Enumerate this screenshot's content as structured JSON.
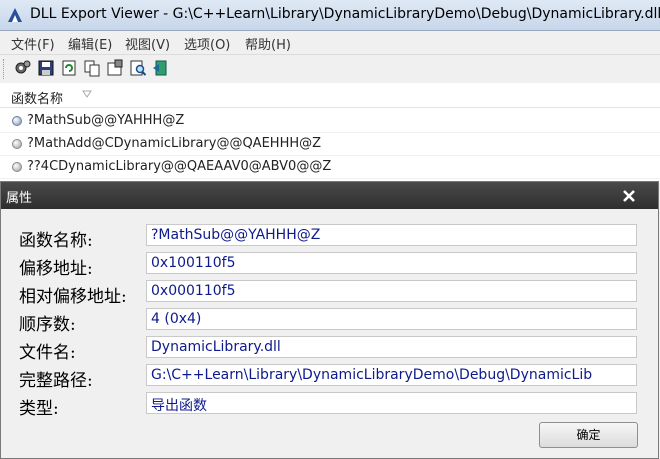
{
  "window": {
    "title": "DLL Export Viewer   -   G:\\C++Learn\\Library\\DynamicLibraryDemo\\Debug\\DynamicLibrary.dll"
  },
  "menu": {
    "items": [
      {
        "label": "文件(F)"
      },
      {
        "label": "编辑(E)"
      },
      {
        "label": "视图(V)"
      },
      {
        "label": "选项(O)"
      },
      {
        "label": "帮助(H)"
      }
    ]
  },
  "toolbar": {
    "buttons": [
      "properties-icon",
      "save-icon",
      "refresh-icon",
      "copy-icon",
      "properties-sheet-icon",
      "find-icon",
      "exit-icon"
    ]
  },
  "list": {
    "column_header": "函数名称",
    "rows": [
      {
        "name": "?MathSub@@YAHHH@Z"
      },
      {
        "name": "?MathAdd@CDynamicLibrary@@QAEHHH@Z"
      },
      {
        "name": "??4CDynamicLibrary@@QAEAAV0@ABV0@@Z"
      }
    ]
  },
  "dialog": {
    "title": "属性",
    "close_label": "X",
    "fields": [
      {
        "label": "函数名称:",
        "value": "?MathSub@@YAHHH@Z"
      },
      {
        "label": "偏移地址:",
        "value": "0x100110f5"
      },
      {
        "label": "相对偏移地址:",
        "value": "0x000110f5"
      },
      {
        "label": "顺序数:",
        "value": "4 (0x4)"
      },
      {
        "label": "文件名:",
        "value": "DynamicLibrary.dll"
      },
      {
        "label": "完整路径:",
        "value": "G:\\C++Learn\\Library\\DynamicLibraryDemo\\Debug\\DynamicLib"
      },
      {
        "label": "类型:",
        "value": "导出函数"
      }
    ],
    "ok_label": "确定"
  }
}
